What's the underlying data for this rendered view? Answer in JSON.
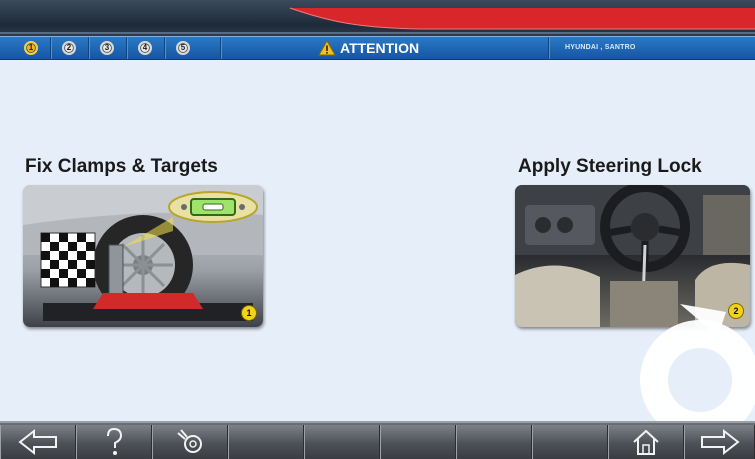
{
  "status_bar": {
    "steps": [
      {
        "label": "1",
        "active": true
      },
      {
        "label": "2",
        "active": false
      },
      {
        "label": "3",
        "active": false
      },
      {
        "label": "4",
        "active": false
      },
      {
        "label": "5",
        "active": false
      }
    ],
    "attention_label": "ATTENTION",
    "vehicle_label": "HYUNDAI , SANTRO"
  },
  "instructions": [
    {
      "title": "Fix Clamps & Targets",
      "step_badge": "1",
      "image": "wheel-clamp-target-illustration"
    },
    {
      "title": "Apply Steering Lock",
      "step_badge": "2",
      "image": "steering-lock-interior-illustration"
    }
  ],
  "toolbar": {
    "buttons": [
      {
        "icon": "back-arrow-icon"
      },
      {
        "icon": "help-icon"
      },
      {
        "icon": "tools-icon"
      },
      {
        "icon": "empty"
      },
      {
        "icon": "empty"
      },
      {
        "icon": "empty"
      },
      {
        "icon": "empty"
      },
      {
        "icon": "empty"
      },
      {
        "icon": "home-icon"
      },
      {
        "icon": "forward-arrow-icon"
      }
    ]
  },
  "colors": {
    "status_bar": "#1f69b8",
    "background": "#e6eef9",
    "accent_red": "#d8262a",
    "badge_yellow": "#f3d21e"
  }
}
